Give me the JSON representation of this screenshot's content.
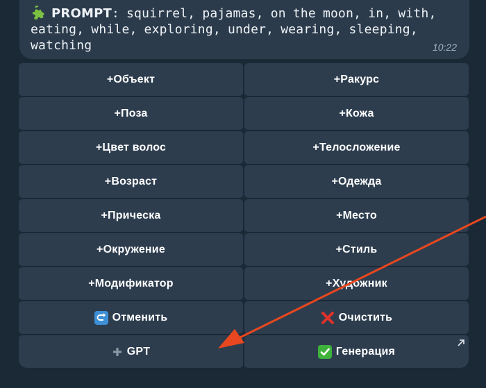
{
  "message": {
    "lead": "PROMPT",
    "body": ": squirrel, pajamas, on the moon, in, with, eating, while, exploring, under, wearing, sleeping, watching",
    "time": "10:22",
    "icon": "puzzle-piece-icon"
  },
  "keyboard": {
    "buttons": [
      {
        "label": "+Объект"
      },
      {
        "label": "+Ракурс"
      },
      {
        "label": "+Поза"
      },
      {
        "label": "+Кожа"
      },
      {
        "label": "+Цвет волос"
      },
      {
        "label": "+Телосложение"
      },
      {
        "label": "+Возраст"
      },
      {
        "label": "+Одежда"
      },
      {
        "label": "+Прическа"
      },
      {
        "label": "+Место"
      },
      {
        "label": "+Окружение"
      },
      {
        "label": "+Стиль"
      },
      {
        "label": "+Модификатор"
      },
      {
        "label": "+Художник"
      },
      {
        "label": "Отменить",
        "icon": "undo-arrow-icon"
      },
      {
        "label": "Очистить",
        "icon": "red-cross-icon"
      },
      {
        "label": "GPT",
        "icon": "plus-icon"
      },
      {
        "label": "Генерация",
        "icon": "check-mark-icon"
      }
    ]
  },
  "colors": {
    "background": "#1b2836",
    "button": "#2d3d4e",
    "bubble": "#2b3b4c",
    "annotation_arrow": "#e8471f",
    "check": "#3fb23c",
    "cross": "#e0312b",
    "undo": "#3d8fd6"
  }
}
